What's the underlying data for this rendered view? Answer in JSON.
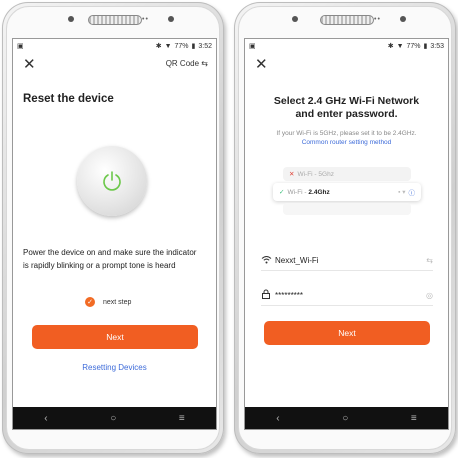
{
  "left_screen": {
    "status": {
      "battery": "77%",
      "time": "3:52"
    },
    "qr_code_label": "QR Code",
    "title": "Reset the device",
    "description": "Power the device on and make sure the indicator is rapidly blinking or a prompt tone is heard",
    "checkbox_label": "next step",
    "next_button": "Next",
    "reset_link": "Resetting Devices"
  },
  "right_screen": {
    "status": {
      "battery": "77%",
      "time": "3:53"
    },
    "title_line1": "Select 2.4 GHz Wi-Fi Network",
    "title_line2": "and enter password.",
    "subtitle": "If your Wi-Fi is 5GHz, please set it to be 2.4GHz.",
    "router_link": "Common router setting method",
    "wifi_bad_prefix": "Wi-Fi -",
    "wifi_bad_band": "5Ghz",
    "wifi_good_prefix": "Wi-Fi -",
    "wifi_good_band": "2.4Ghz",
    "network_name": "Nexxt_Wi-Fi",
    "password": "*********",
    "next_button": "Next"
  },
  "nav": {
    "back": "‹",
    "home": "○",
    "menu": "≡"
  },
  "colors": {
    "accent": "#f15e22",
    "link": "#3d6bd9",
    "power_icon": "#6cc84a"
  },
  "icons": [
    "close-icon",
    "swap-icon",
    "power-icon",
    "check-icon",
    "wifi-icon",
    "lock-icon",
    "eye-icon",
    "info-icon"
  ]
}
